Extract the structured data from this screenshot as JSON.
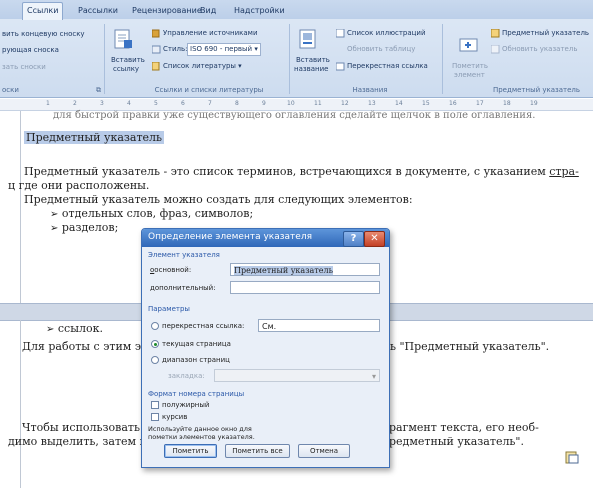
{
  "ribbon": {
    "tabs": [
      {
        "label": "Ссылки",
        "active": true
      },
      {
        "label": "Рассылки"
      },
      {
        "label": "Рецензирование"
      },
      {
        "label": "Вид"
      },
      {
        "label": "Надстройки"
      }
    ],
    "footnotes": {
      "items": [
        "вить концевую сноску",
        "рующая сноска",
        "зать сноски"
      ],
      "group_label": "оски"
    },
    "citations": {
      "insert_label_1": "Вставить",
      "insert_label_2": "ссылку",
      "manage_sources": "Управление источниками",
      "style_label": "Стиль:",
      "style_value": "ISO 690 - первый",
      "bibliography": "Список литературы",
      "group_label": "Ссылки и списки литературы"
    },
    "captions": {
      "insert_label_1": "Вставить",
      "insert_label_2": "название",
      "table_of_figures": "Список иллюстраций",
      "update_table": "Обновить таблицу",
      "cross_reference": "Перекрестная ссылка",
      "group_label": "Названия"
    },
    "index": {
      "mark_label_1": "Пометить",
      "mark_label_2": "элемент",
      "insert_index": "Предметный указатель",
      "update_index": "Обновить указатель",
      "group_label": "Предметный указатель"
    }
  },
  "ruler": {
    "ticks": [
      "1",
      "2",
      "3",
      "4",
      "5",
      "6",
      "7",
      "8",
      "9",
      "10",
      "11",
      "12",
      "13",
      "14",
      "15",
      "16",
      "17",
      "18",
      "19"
    ]
  },
  "document": {
    "cut_line": "для быстрой правки уже существующего оглавления сделайте щелчок в поле оглавления.",
    "heading": "Предметный указатель",
    "para1_a": "Предметный указатель - это список терминов, встречающихся в документе, с указанием ",
    "para1_b": "стра-",
    "para1_line2": "ц где они расположены.",
    "para2": "Предметный указатель можно создать для следующих элементов:",
    "bullets_top": [
      "отдельных слов, фраз, символов;",
      "разделов;"
    ],
    "bullet_bottom": "ссылок.",
    "para3_left": "Для работы с этим эл",
    "para3_right": "ь \"Предметный указатель\".",
    "para4_left": "Чтобы использовать",
    "para4_right": "рагмент текста, его необ-",
    "para5_left": "димо выделить, затем на",
    "para5_right": "редметный указатель\"."
  },
  "dialog": {
    "title": "Определение элемента указателя",
    "help_icon": "?",
    "close_icon": "✕",
    "section_entry": "Элемент указателя",
    "main_label": "основной:",
    "main_value": "Предметный указатель",
    "sub_label": "дополнительный:",
    "sub_value": "",
    "section_options": "Параметры",
    "opt_cross_ref": "перекрестная ссылка:",
    "cross_ref_value": "См.",
    "opt_current_page": "текущая страница",
    "opt_page_range": "диапазон страниц",
    "bookmark_label": "закладка:",
    "section_page_format": "Формат номера страницы",
    "bold_label": "полужирный",
    "italic_label": "курсив",
    "note": "Используйте данное окно для пометки элементов указателя.",
    "mark_button": "Пометить",
    "mark_all_button": "Пометить все",
    "cancel_button": "Отмена",
    "selected_option": "current_page"
  },
  "colors": {
    "dialog_title": "#2f67b8",
    "selection": "#b8cbe8",
    "ribbon": "#dfe9f6"
  }
}
